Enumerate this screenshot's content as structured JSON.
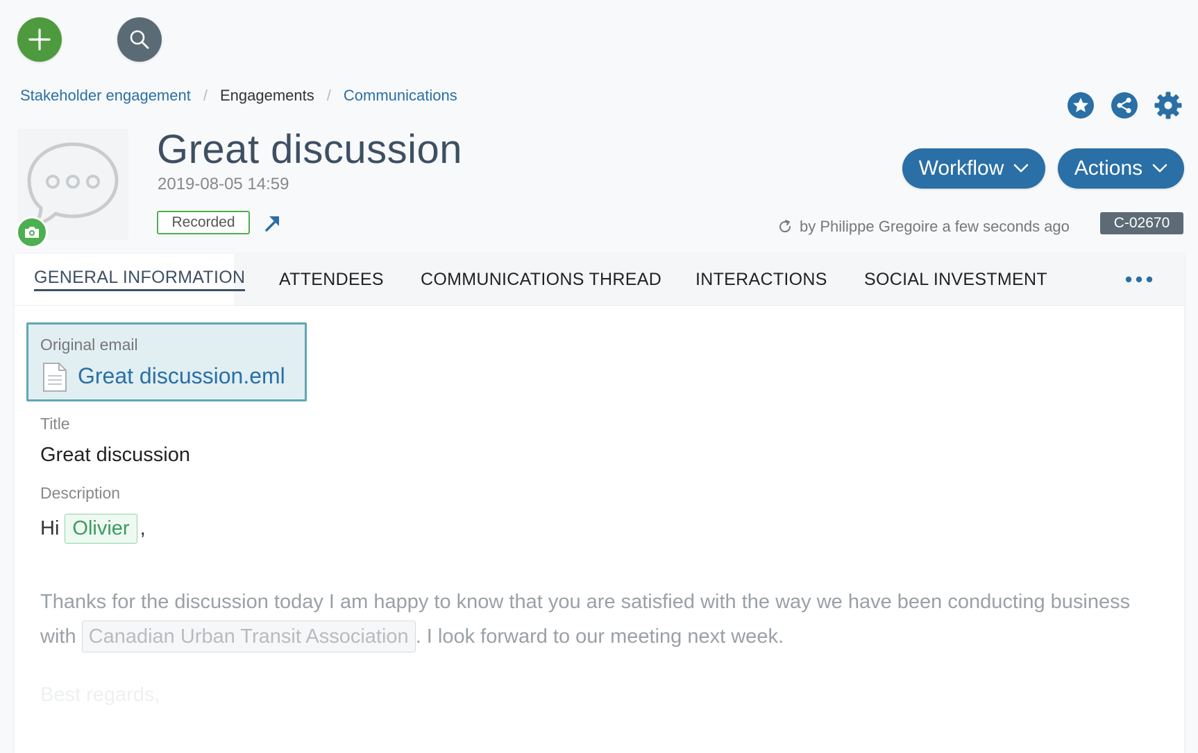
{
  "breadcrumb": {
    "items": [
      "Stakeholder engagement",
      "Engagements",
      "Communications"
    ],
    "separator": "/"
  },
  "header": {
    "title": "Great discussion",
    "date": "2019-08-05 14:59",
    "status": "Recorded",
    "workflow_label": "Workflow",
    "actions_label": "Actions",
    "modified_text": "by Philippe Gregoire a few seconds ago",
    "record_id": "C-02670"
  },
  "tabs": [
    {
      "label": "GENERAL INFORMATION",
      "active": true
    },
    {
      "label": "ATTENDEES"
    },
    {
      "label": "COMMUNICATIONS THREAD"
    },
    {
      "label": "INTERACTIONS"
    },
    {
      "label": "SOCIAL INVESTMENT"
    }
  ],
  "original_email": {
    "label": "Original email",
    "file_name": "Great discussion.eml"
  },
  "fields": {
    "title_label": "Title",
    "title_value": "Great discussion",
    "description_label": "Description"
  },
  "description": {
    "greeting": "Hi",
    "mention_person": "Olivier",
    "greeting_punct": ",",
    "para_before": "Thanks for the discussion today I am happy to know that you are satisfied with the way we have been conducting business with",
    "mention_org": "Canadian Urban Transit Association",
    "para_after": ". I look forward to our meeting next week.",
    "signoff": "Best regards,"
  },
  "colors": {
    "primary": "#2a6fa6",
    "add_button": "#4e9a3e",
    "search_button": "#5a6b75",
    "status_border": "#4caf50",
    "id_badge": "#5c6b75",
    "title_text": "#3e4f63"
  },
  "icons": [
    "plus-icon",
    "search-icon",
    "star-icon",
    "share-icon",
    "gear-icon",
    "chat-bubble-icon",
    "camera-icon",
    "external-link-icon",
    "refresh-icon",
    "chevron-down-icon",
    "more-dots-icon",
    "document-icon"
  ]
}
